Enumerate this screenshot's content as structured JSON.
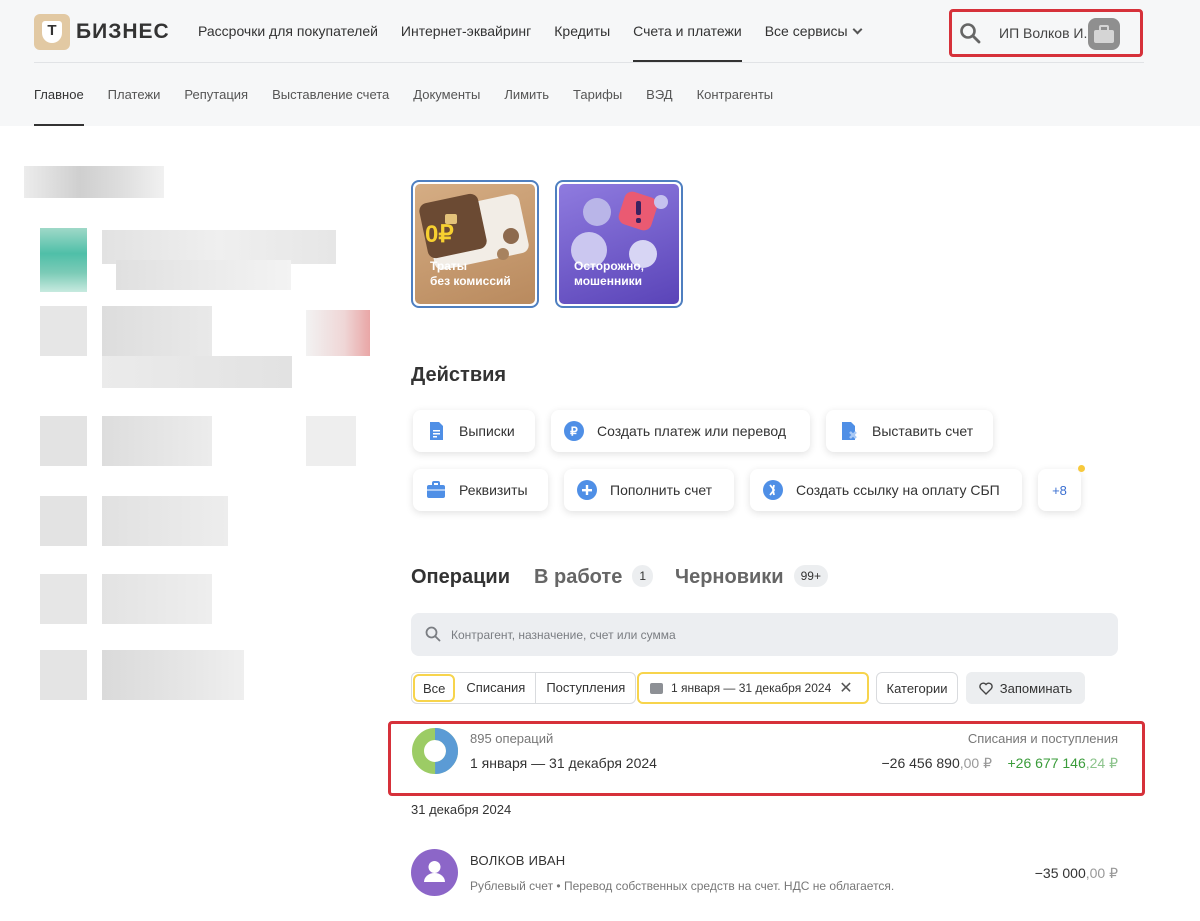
{
  "brand": {
    "logo_letter": "T",
    "name": "БИЗНЕС"
  },
  "topnav": [
    {
      "label": "Рассрочки для покупателей"
    },
    {
      "label": "Интернет-эквайринг"
    },
    {
      "label": "Кредиты"
    },
    {
      "label": "Счета и платежи",
      "active": true
    },
    {
      "label": "Все сервисы"
    }
  ],
  "user": {
    "name": "ИП Волков И."
  },
  "subnav": [
    {
      "label": "Главное",
      "active": true
    },
    {
      "label": "Платежи"
    },
    {
      "label": "Репутация"
    },
    {
      "label": "Выставление счета"
    },
    {
      "label": "Документы"
    },
    {
      "label": "Лимить"
    },
    {
      "label": "Тарифы"
    },
    {
      "label": "ВЭД"
    },
    {
      "label": "Контрагенты"
    }
  ],
  "stories": [
    {
      "caption_line1": "Траты",
      "caption_line2": "без комиссий",
      "badge": "0₽"
    },
    {
      "caption_line1": "Осторожно,",
      "caption_line2": "мошенники"
    }
  ],
  "actions_title": "Действия",
  "actions": [
    {
      "label": "Выписки",
      "icon": "document-icon"
    },
    {
      "label": "Создать платеж или перевод",
      "icon": "ruble-icon"
    },
    {
      "label": "Выставить счет",
      "icon": "invoice-icon"
    },
    {
      "label": "Реквизиты",
      "icon": "briefcase-icon"
    },
    {
      "label": "Пополнить счет",
      "icon": "plus-icon"
    },
    {
      "label": "Создать ссылку на оплату СБП",
      "icon": "sbp-icon"
    },
    {
      "label": "+8",
      "icon": "more"
    }
  ],
  "ops_tabs": [
    {
      "label": "Операции",
      "active": true
    },
    {
      "label": "В работе",
      "count": "1"
    },
    {
      "label": "Черновики",
      "count": "99+"
    }
  ],
  "search": {
    "placeholder": "Контрагент, назначение, счет или сумма"
  },
  "filters": {
    "segments": [
      "Все",
      "Списания",
      "Поступления"
    ],
    "date_range": "1 января — 31 декабря 2024",
    "categories": "Категории",
    "remember": "Запоминать"
  },
  "summary": {
    "count": "895 операций",
    "range": "1 января — 31 декабря 2024",
    "label": "Списания и поступления",
    "out_main": "−26 456 890",
    "out_cents": ",00 ₽",
    "in_main": "+26 677 146",
    "in_cents": ",24 ₽",
    "colors": {
      "out": "#5b9bd5",
      "in": "#9ccc65"
    }
  },
  "day_label": "31 декабря 2024",
  "operation": {
    "title": "ВОЛКОВ ИВАН",
    "desc": "Рублевый счет • Перевод собственных средств на счет. НДС не облагается.",
    "amount_main": "−35 000",
    "amount_cents": ",00 ₽"
  }
}
